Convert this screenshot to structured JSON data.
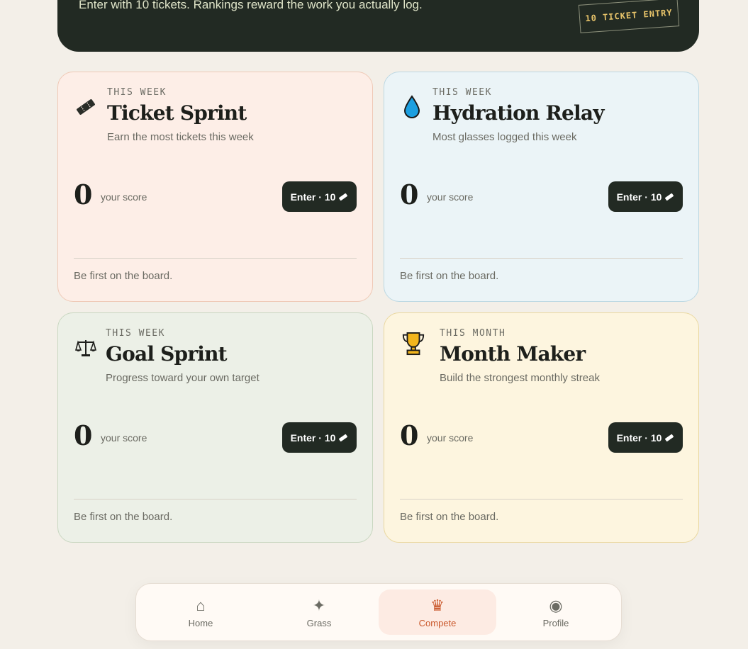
{
  "hero": {
    "text": "Enter with 10 tickets. Rankings reward the work you actually log.",
    "tag": "10 TICKET ENTRY"
  },
  "cards": [
    {
      "icon": "ticket-icon",
      "period": "THIS WEEK",
      "title": "Ticket Sprint",
      "subtitle": "Earn the most tickets this week",
      "score": "0",
      "score_label": "your score",
      "enter_label": "Enter · 10",
      "board_text": "Be first on the board."
    },
    {
      "icon": "droplet-icon",
      "period": "THIS WEEK",
      "title": "Hydration Relay",
      "subtitle": "Most glasses logged this week",
      "score": "0",
      "score_label": "your score",
      "enter_label": "Enter · 10",
      "board_text": "Be first on the board."
    },
    {
      "icon": "scales-icon",
      "period": "THIS WEEK",
      "title": "Goal Sprint",
      "subtitle": "Progress toward your own target",
      "score": "0",
      "score_label": "your score",
      "enter_label": "Enter · 10",
      "board_text": "Be first on the board."
    },
    {
      "icon": "trophy-icon",
      "period": "THIS MONTH",
      "title": "Month Maker",
      "subtitle": "Build the strongest monthly streak",
      "score": "0",
      "score_label": "your score",
      "enter_label": "Enter · 10",
      "board_text": "Be first on the board."
    }
  ],
  "nav": {
    "items": [
      {
        "label": "Home",
        "icon": "home-icon",
        "glyph": "⌂"
      },
      {
        "label": "Grass",
        "icon": "sparkle-icon",
        "glyph": "✦"
      },
      {
        "label": "Compete",
        "icon": "crown-icon",
        "glyph": "♛"
      },
      {
        "label": "Profile",
        "icon": "profile-icon",
        "glyph": "◉"
      }
    ],
    "active": "Compete"
  },
  "colors": {
    "dark": "#222a23",
    "accent": "#c9572a",
    "tag_text": "#e8c46a"
  }
}
